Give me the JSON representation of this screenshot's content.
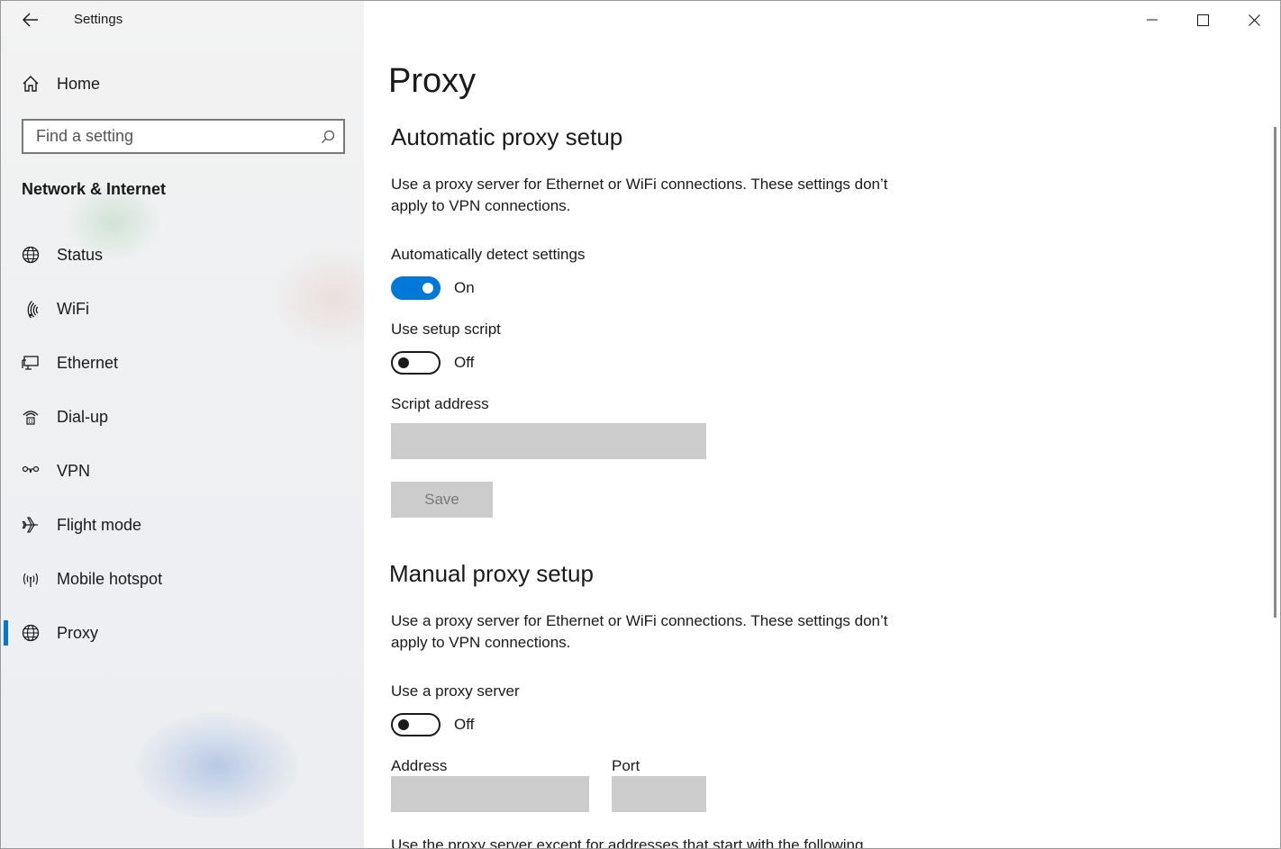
{
  "app": {
    "title": "Settings"
  },
  "sidebar": {
    "home_label": "Home",
    "search_placeholder": "Find a setting",
    "section_heading": "Network & Internet",
    "items": [
      {
        "label": "Status",
        "icon": "globe-status-icon"
      },
      {
        "label": "WiFi",
        "icon": "wifi-icon"
      },
      {
        "label": "Ethernet",
        "icon": "ethernet-icon"
      },
      {
        "label": "Dial-up",
        "icon": "dial-up-icon"
      },
      {
        "label": "VPN",
        "icon": "vpn-icon"
      },
      {
        "label": "Flight mode",
        "icon": "airplane-icon"
      },
      {
        "label": "Mobile hotspot",
        "icon": "hotspot-icon"
      },
      {
        "label": "Proxy",
        "icon": "globe-icon",
        "active": true
      }
    ]
  },
  "main": {
    "title": "Proxy",
    "auto": {
      "heading": "Automatic proxy setup",
      "description": "Use a proxy server for Ethernet or WiFi connections. These settings don’t apply to VPN connections.",
      "detect_label": "Automatically detect settings",
      "detect_state": "On",
      "script_label": "Use setup script",
      "script_state": "Off",
      "address_label": "Script address",
      "address_value": "",
      "save_label": "Save"
    },
    "manual": {
      "heading": "Manual proxy setup",
      "description": "Use a proxy server for Ethernet or WiFi connections. These settings don’t apply to VPN connections.",
      "use_proxy_label": "Use a proxy server",
      "use_proxy_state": "Off",
      "address_label": "Address",
      "port_label": "Port",
      "address_value": "",
      "port_value": "",
      "exceptions_text": "Use the proxy server except for addresses that start with the following"
    }
  },
  "colors": {
    "accent": "#0078d7",
    "disabled_fill": "#cccccc"
  }
}
